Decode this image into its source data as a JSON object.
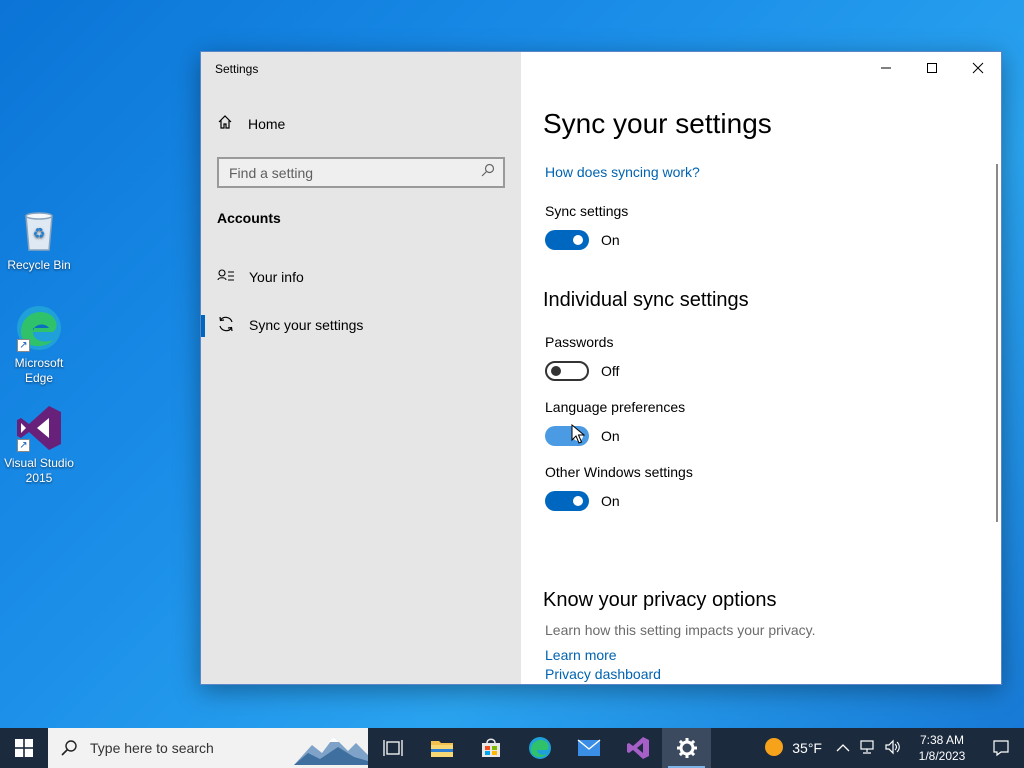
{
  "desktop": {
    "icons": [
      {
        "label": "Recycle Bin"
      },
      {
        "label": "Microsoft\nEdge"
      },
      {
        "label": "Visual Studio\n2015"
      }
    ]
  },
  "window": {
    "app_title": "Settings",
    "sidebar": {
      "home_label": "Home",
      "search_placeholder": "Find a setting",
      "section": "Accounts",
      "items": [
        {
          "label": "Your info",
          "active": false
        },
        {
          "label": "Sync your settings",
          "active": true
        }
      ]
    },
    "content": {
      "title": "Sync your settings",
      "help_link": "How does syncing work?",
      "sync_settings": {
        "label": "Sync settings",
        "state": "On"
      },
      "individual_heading": "Individual sync settings",
      "passwords": {
        "label": "Passwords",
        "state": "Off"
      },
      "language": {
        "label": "Language preferences",
        "state": "On"
      },
      "other": {
        "label": "Other Windows settings",
        "state": "On"
      },
      "privacy_heading": "Know your privacy options",
      "privacy_text": "Learn how this setting impacts your privacy.",
      "learn_more": "Learn more",
      "privacy_dashboard": "Privacy dashboard"
    }
  },
  "taskbar": {
    "search_placeholder": "Type here to search",
    "weather": "35°F",
    "time": "7:38 AM",
    "date": "1/8/2023"
  },
  "colors": {
    "accent": "#0067c0",
    "link": "#0063b1",
    "taskbar": "#1b2a3d"
  }
}
